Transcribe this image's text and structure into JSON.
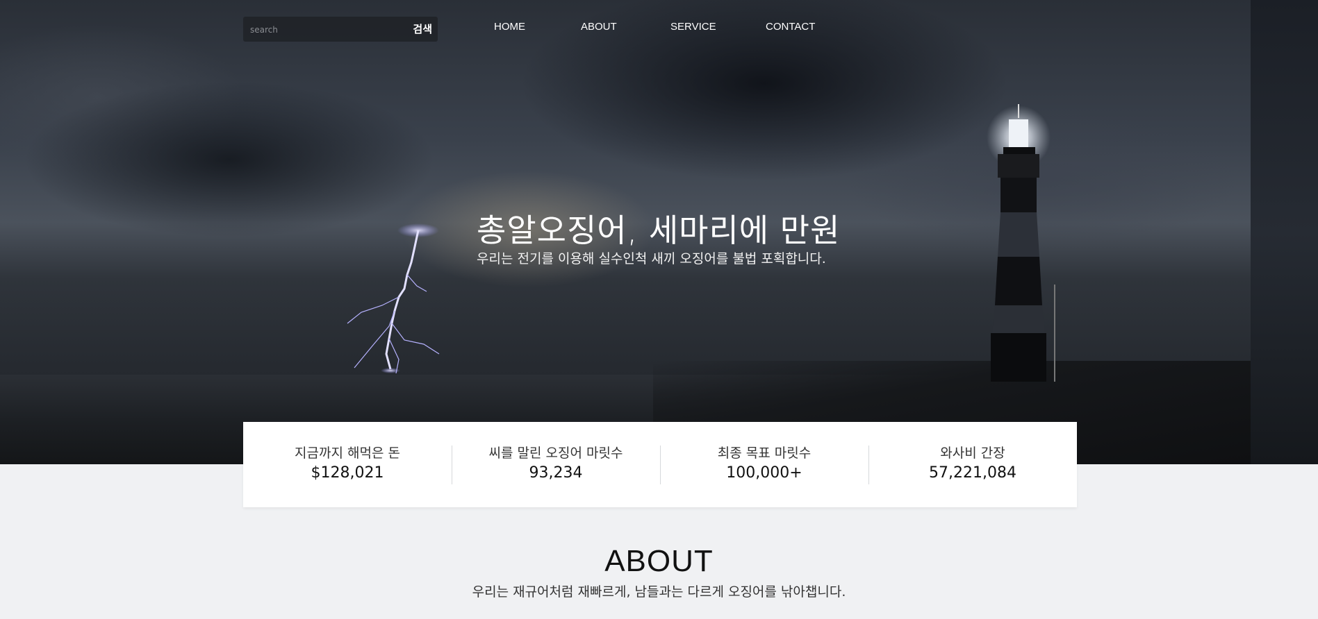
{
  "search": {
    "placeholder": "search",
    "button_label": "검색"
  },
  "nav": {
    "items": [
      "HOME",
      "ABOUT",
      "SERVICE",
      "CONTACT"
    ]
  },
  "hero": {
    "title": "총알오징어, 세마리에 만원",
    "subtitle": "우리는 전기를 이용해 실수인척 새끼 오징어를 불법 포획합니다."
  },
  "stats": [
    {
      "label": "지금까지 해먹은 돈",
      "value": "$128,021"
    },
    {
      "label": "씨를 말린 오징어 마릿수",
      "value": "93,234"
    },
    {
      "label": "최종 목표 마릿수",
      "value": "100,000+"
    },
    {
      "label": "와사비 간장",
      "value": "57,221,084"
    }
  ],
  "about": {
    "title": "ABOUT",
    "subtitle": "우리는 재규어처럼 재빠르게, 남들과는 다르게 오징어를 낚아챕니다."
  }
}
